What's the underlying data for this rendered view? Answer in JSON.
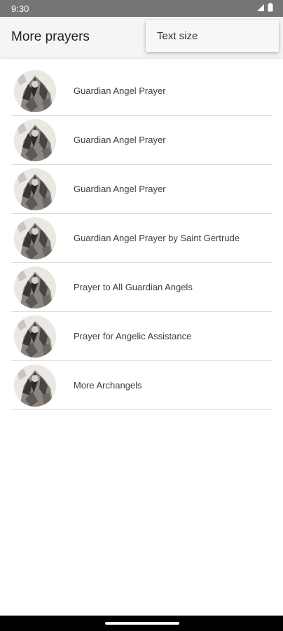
{
  "status_bar": {
    "time": "9:30"
  },
  "app_bar": {
    "title": "More prayers"
  },
  "overflow_menu": {
    "items": [
      {
        "label": "Text size"
      }
    ]
  },
  "prayers": [
    {
      "label": "Guardian Angel Prayer"
    },
    {
      "label": "Guardian Angel Prayer"
    },
    {
      "label": "Guardian Angel Prayer"
    },
    {
      "label": "Guardian Angel Prayer by Saint Gertrude"
    },
    {
      "label": "Prayer to All Guardian Angels"
    },
    {
      "label": "Prayer for Angelic Assistance"
    },
    {
      "label": "More Archangels"
    }
  ],
  "colors": {
    "status_bar": "#757575",
    "app_bar": "#f5f5f5",
    "divider": "#dcdcdc",
    "nav_bar": "#000000"
  },
  "icons": [
    "signal-icon",
    "battery-icon",
    "angel-thumbnail"
  ]
}
